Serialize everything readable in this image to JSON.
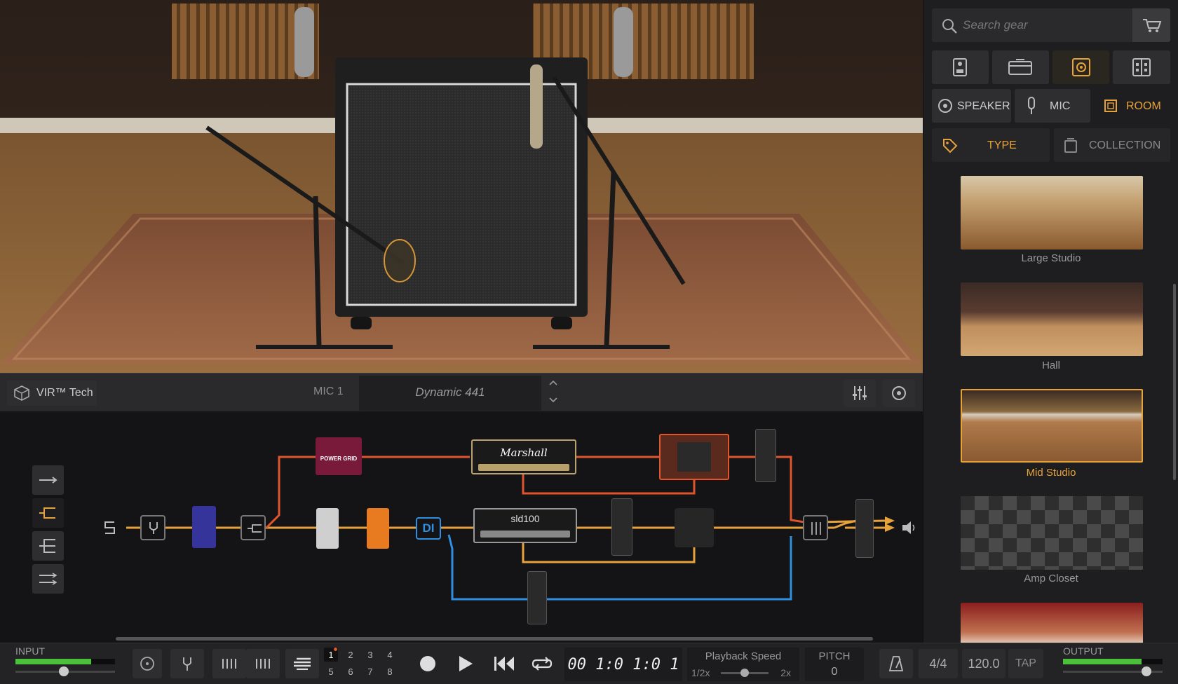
{
  "browser": {
    "search_placeholder": "Search gear",
    "categories": [
      {
        "id": "stomp",
        "icon": "stompbox-icon"
      },
      {
        "id": "amp",
        "icon": "amp-icon"
      },
      {
        "id": "cab",
        "icon": "cabinet-icon"
      },
      {
        "id": "rack",
        "icon": "rack-icon"
      }
    ],
    "subtabs": {
      "speaker": "SPEAKER",
      "mic": "MIC",
      "room": "ROOM"
    },
    "filters": {
      "type": "TYPE",
      "collection": "COLLECTION"
    },
    "rooms": [
      {
        "name": "Large Studio",
        "selected": false
      },
      {
        "name": "Hall",
        "selected": false
      },
      {
        "name": "Mid Studio",
        "selected": true
      },
      {
        "name": "Amp Closet",
        "selected": false
      }
    ],
    "accent": "#e8a23a"
  },
  "mic_bar": {
    "vir_label": "VIR™ Tech",
    "mic_label": "MIC 1",
    "mic_model": "Dynamic 441"
  },
  "chain": {
    "cab_brand": "Marshall",
    "amp2_brand": "sld100",
    "di_label": "DI",
    "pedal_label": "POWER GRID",
    "colors": {
      "signal": "#e8a23a",
      "red": "#e0542e",
      "blue": "#2f8fe0"
    }
  },
  "transport": {
    "input_label": "INPUT",
    "output_label": "OUTPUT",
    "tracks": [
      "1",
      "2",
      "3",
      "4",
      "5",
      "6",
      "7",
      "8"
    ],
    "time": "00 1:0 1:0 1",
    "playback_speed_label": "Playback Speed",
    "speed_min": "1/2x",
    "speed_max": "2x",
    "pitch_label": "PITCH",
    "pitch_value": "0",
    "time_signature": "4/4",
    "tempo": "120.0",
    "tap_label": "TAP"
  }
}
